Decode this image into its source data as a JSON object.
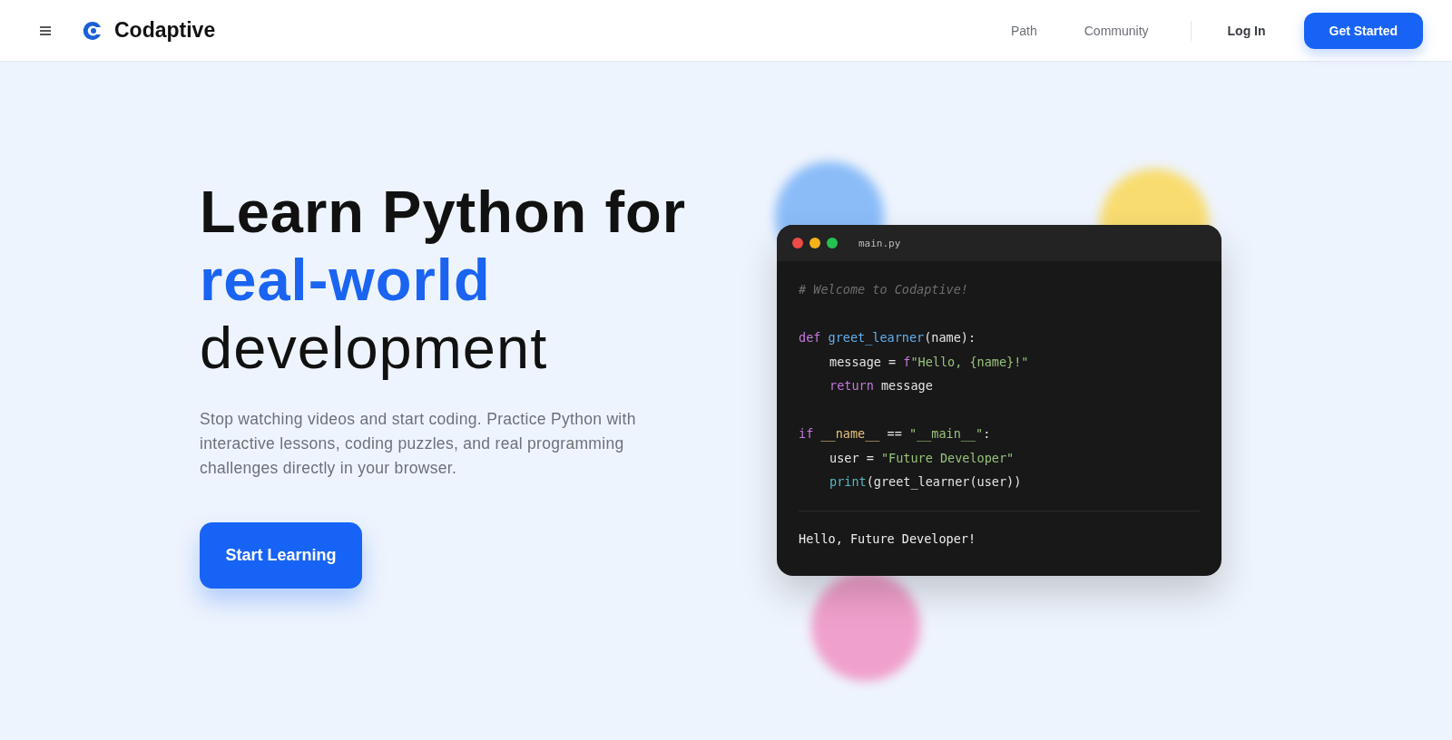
{
  "header": {
    "brand": "Codaptive",
    "nav": [
      "Path",
      "Community"
    ],
    "login": "Log In",
    "cta": "Get Started"
  },
  "hero": {
    "heading": [
      {
        "text": "Learn Python for",
        "kind": "strong"
      },
      {
        "text": "real-world",
        "kind": "accent"
      },
      {
        "text": "development",
        "kind": "light"
      }
    ],
    "description": "Stop watching videos and start coding. Practice Python with interactive lessons, coding puzzles, and real programming challenges directly in your browser.",
    "button": "Start Learning"
  },
  "editor": {
    "filename": "main.py",
    "lines": [
      {
        "indent": false,
        "tokens": [
          {
            "kind": "comment",
            "text": "# Welcome to Codaptive!"
          }
        ]
      },
      {
        "kind": "blank"
      },
      {
        "indent": false,
        "tokens": [
          {
            "kind": "keyword",
            "text": "def "
          },
          {
            "kind": "function",
            "text": "greet_learner"
          },
          {
            "kind": "plain",
            "text": "(name):"
          }
        ]
      },
      {
        "indent": true,
        "tokens": [
          {
            "kind": "plain",
            "text": "message = "
          },
          {
            "kind": "keyword",
            "text": "f"
          },
          {
            "kind": "string",
            "text": "\"Hello, {name}!\""
          }
        ]
      },
      {
        "indent": true,
        "tokens": [
          {
            "kind": "keyword",
            "text": "return"
          },
          {
            "kind": "plain",
            "text": " message"
          }
        ]
      },
      {
        "kind": "blank"
      },
      {
        "indent": false,
        "tokens": [
          {
            "kind": "keyword",
            "text": "if "
          },
          {
            "kind": "dunder",
            "text": "__name__"
          },
          {
            "kind": "plain",
            "text": " == "
          },
          {
            "kind": "string",
            "text": "\"__main__\""
          },
          {
            "kind": "plain",
            "text": ":"
          }
        ]
      },
      {
        "indent": true,
        "tokens": [
          {
            "kind": "plain",
            "text": "user = "
          },
          {
            "kind": "string",
            "text": "\"Future Developer\""
          }
        ]
      },
      {
        "indent": true,
        "tokens": [
          {
            "kind": "builtin",
            "text": "print"
          },
          {
            "kind": "plain",
            "text": "(greet_learner(user))"
          }
        ]
      }
    ],
    "output": "Hello, Future Developer!"
  }
}
